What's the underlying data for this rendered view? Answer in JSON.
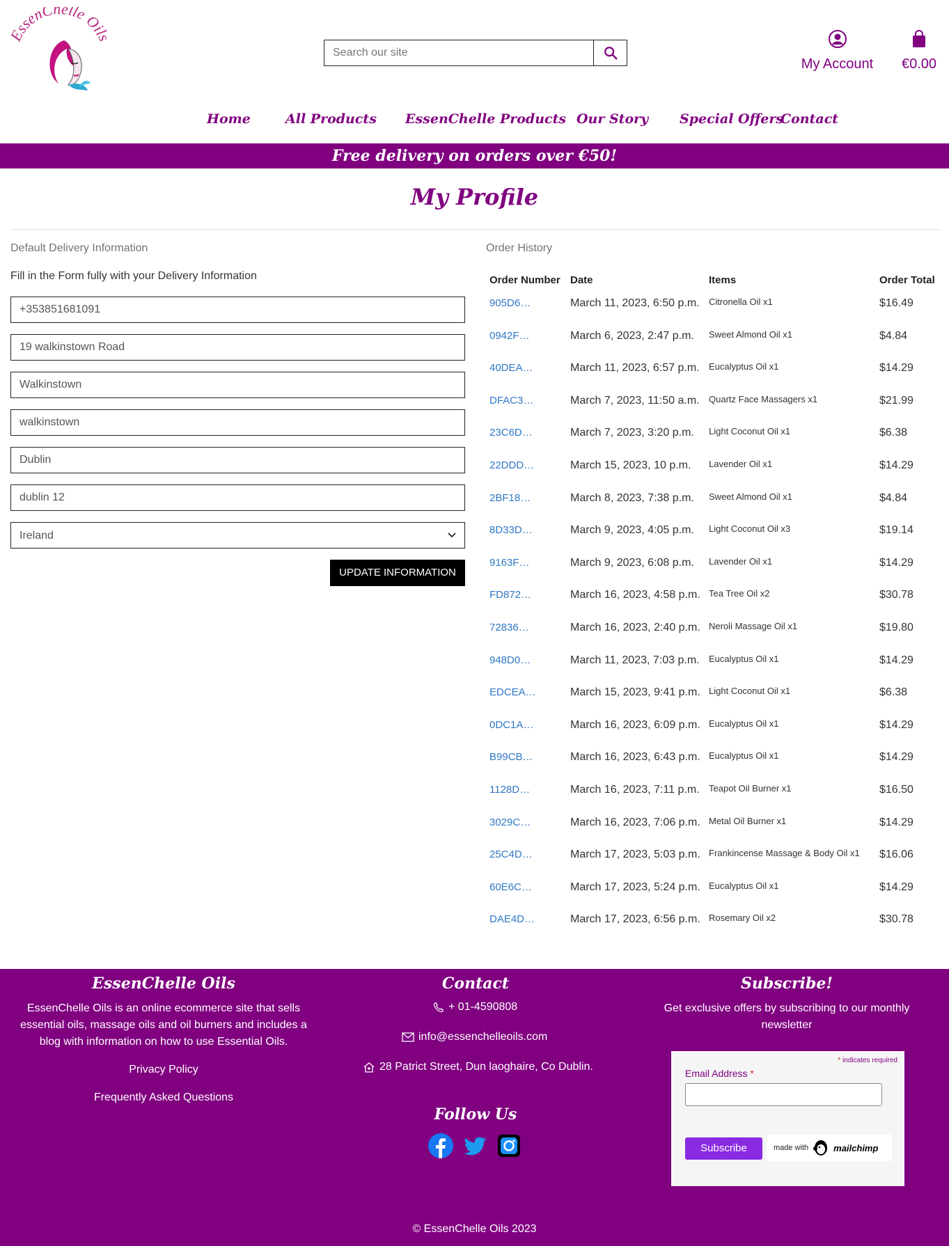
{
  "header": {
    "logo_text": "EssenChelle Oils",
    "search_placeholder": "Search our site",
    "account_label": "My Account",
    "cart_total": "€0.00"
  },
  "nav": {
    "items": [
      "Home",
      "All Products",
      "EssenChelle Products",
      "Our Story",
      "Special Offers",
      "Contact"
    ]
  },
  "banner": "Free delivery on orders over €50!",
  "page_title": "My Profile",
  "delivery": {
    "section_label": "Default Delivery Information",
    "intro": "Fill in the Form fully with your Delivery Information",
    "fields": [
      "+353851681091",
      "19 walkinstown Road",
      "Walkinstown",
      "walkinstown",
      "Dublin",
      "dublin 12"
    ],
    "country": "Ireland",
    "update_button": "UPDATE INFORMATION"
  },
  "orders": {
    "section_label": "Order History",
    "headers": [
      "Order Number",
      "Date",
      "Items",
      "Order Total"
    ],
    "rows": [
      {
        "num": "905D6…",
        "date": "March 11, 2023, 6:50 p.m.",
        "items": "Citronella Oil x1",
        "total": "$16.49"
      },
      {
        "num": "0942F…",
        "date": "March 6, 2023, 2:47 p.m.",
        "items": "Sweet Almond Oil x1",
        "total": "$4.84"
      },
      {
        "num": "40DEA…",
        "date": "March 11, 2023, 6:57 p.m.",
        "items": "Eucalyptus Oil x1",
        "total": "$14.29"
      },
      {
        "num": "DFAC3…",
        "date": "March 7, 2023, 11:50 a.m.",
        "items": "Quartz Face Massagers x1",
        "total": "$21.99"
      },
      {
        "num": "23C6D…",
        "date": "March 7, 2023, 3:20 p.m.",
        "items": "Light Coconut Oil x1",
        "total": "$6.38"
      },
      {
        "num": "22DDD…",
        "date": "March 15, 2023, 10 p.m.",
        "items": "Lavender Oil x1",
        "total": "$14.29"
      },
      {
        "num": "2BF18…",
        "date": "March 8, 2023, 7:38 p.m.",
        "items": "Sweet Almond Oil x1",
        "total": "$4.84"
      },
      {
        "num": "8D33D…",
        "date": "March 9, 2023, 4:05 p.m.",
        "items": "Light Coconut Oil x3",
        "total": "$19.14"
      },
      {
        "num": "9163F…",
        "date": "March 9, 2023, 6:08 p.m.",
        "items": "Lavender Oil x1",
        "total": "$14.29"
      },
      {
        "num": "FD872…",
        "date": "March 16, 2023, 4:58 p.m.",
        "items": "Tea Tree Oil x2",
        "total": "$30.78"
      },
      {
        "num": "72836…",
        "date": "March 16, 2023, 2:40 p.m.",
        "items": "Neroli Massage Oil x1",
        "total": "$19.80"
      },
      {
        "num": "948D0…",
        "date": "March 11, 2023, 7:03 p.m.",
        "items": "Eucalyptus Oil x1",
        "total": "$14.29"
      },
      {
        "num": "EDCEA…",
        "date": "March 15, 2023, 9:41 p.m.",
        "items": "Light Coconut Oil x1",
        "total": "$6.38"
      },
      {
        "num": "0DC1A…",
        "date": "March 16, 2023, 6:09 p.m.",
        "items": "Eucalyptus Oil x1",
        "total": "$14.29"
      },
      {
        "num": "B99CB…",
        "date": "March 16, 2023, 6:43 p.m.",
        "items": "Eucalyptus Oil x1",
        "total": "$14.29"
      },
      {
        "num": "1128D…",
        "date": "March 16, 2023, 7:11 p.m.",
        "items": "Teapot Oil Burner x1",
        "total": "$16.50"
      },
      {
        "num": "3029C…",
        "date": "March 16, 2023, 7:06 p.m.",
        "items": "Metal Oil Burner x1",
        "total": "$14.29"
      },
      {
        "num": "25C4D…",
        "date": "March 17, 2023, 5:03 p.m.",
        "items": "Frankincense Massage & Body Oil x1",
        "total": "$16.06"
      },
      {
        "num": "60E6C…",
        "date": "March 17, 2023, 5:24 p.m.",
        "items": "Eucalyptus Oil x1",
        "total": "$14.29"
      },
      {
        "num": "DAE4D…",
        "date": "March 17, 2023, 6:56 p.m.",
        "items": "Rosemary Oil x2",
        "total": "$30.78"
      }
    ]
  },
  "footer": {
    "about_title": "EssenChelle Oils",
    "about_text": "EssenChelle Oils is an online ecommerce site that sells essential oils, massage oils and oil burners and includes a blog with information on how to use Essential Oils.",
    "privacy_link": "Privacy Policy",
    "faq_link": "Frequently Asked Questions",
    "contact_title": "Contact",
    "phone": "+ 01-4590808",
    "email": "info@essenchelleoils.com",
    "address": "28 Patrict Street, Dun laoghaire, Co Dublin.",
    "follow_title": "Follow Us",
    "subscribe_title": "Subscribe!",
    "subscribe_text": "Get exclusive offers by subscribing to our monthly newsletter",
    "required_note": "indicates required",
    "email_label": "Email Address",
    "subscribe_button": "Subscribe",
    "made_with": "made with",
    "mailchimp": "mailchimp",
    "copyright": "© EssenChelle Oils 2023"
  },
  "colors": {
    "brand": "#800080",
    "link": "#2f78c5",
    "subscribe": "#8a2be2"
  },
  "icons": [
    "search-icon",
    "user-icon",
    "bag-icon",
    "phone-icon",
    "envelope-icon",
    "home-icon",
    "facebook-icon",
    "twitter-icon",
    "instagram-icon"
  ]
}
